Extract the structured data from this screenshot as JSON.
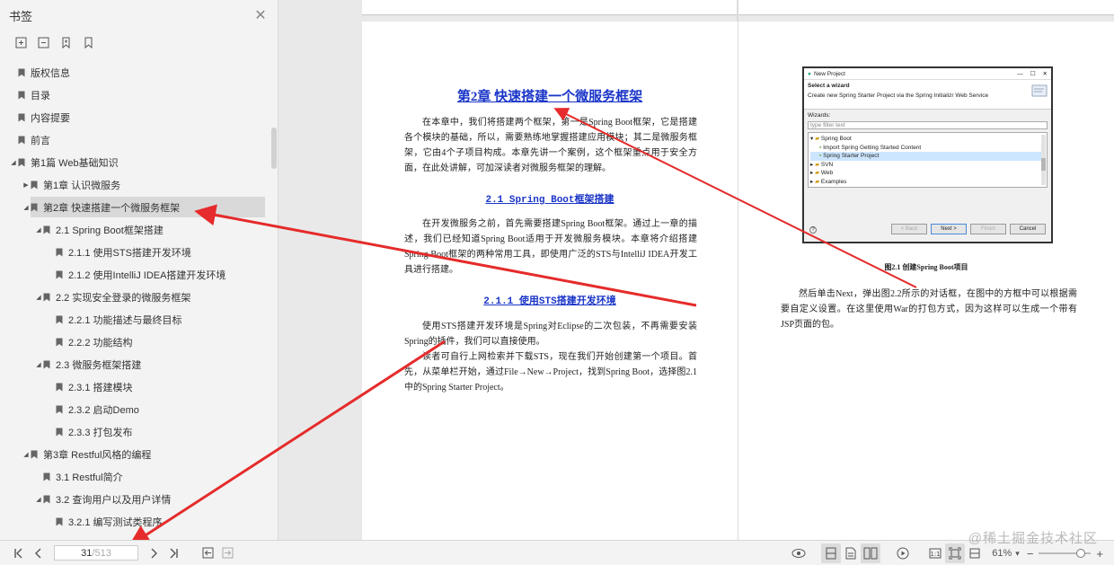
{
  "sidebar": {
    "title": "书签",
    "tree": [
      {
        "label": "版权信息",
        "level": 0,
        "caret": "none"
      },
      {
        "label": "目录",
        "level": 0,
        "caret": "none"
      },
      {
        "label": "内容提要",
        "level": 0,
        "caret": "none"
      },
      {
        "label": "前言",
        "level": 0,
        "caret": "none"
      },
      {
        "label": "第1篇 Web基础知识",
        "level": 0,
        "caret": "down"
      },
      {
        "label": "第1章 认识微服务",
        "level": 1,
        "caret": "right"
      },
      {
        "label": "第2章 快速搭建一个微服务框架",
        "level": 1,
        "caret": "down",
        "selected": true
      },
      {
        "label": "2.1 Spring Boot框架搭建",
        "level": 2,
        "caret": "down"
      },
      {
        "label": "2.1.1 使用STS搭建开发环境",
        "level": 3,
        "caret": "none"
      },
      {
        "label": "2.1.2 使用IntelliJ IDEA搭建开发环境",
        "level": 3,
        "caret": "none"
      },
      {
        "label": "2.2 实现安全登录的微服务框架",
        "level": 2,
        "caret": "down"
      },
      {
        "label": "2.2.1 功能描述与最终目标",
        "level": 3,
        "caret": "none"
      },
      {
        "label": "2.2.2 功能结构",
        "level": 3,
        "caret": "none"
      },
      {
        "label": "2.3 微服务框架搭建",
        "level": 2,
        "caret": "down"
      },
      {
        "label": "2.3.1 搭建模块",
        "level": 3,
        "caret": "none"
      },
      {
        "label": "2.3.2 启动Demo",
        "level": 3,
        "caret": "none"
      },
      {
        "label": "2.3.3 打包发布",
        "level": 3,
        "caret": "none"
      },
      {
        "label": "第3章 Restful风格的编程",
        "level": 1,
        "caret": "down"
      },
      {
        "label": "3.1 Restful简介",
        "level": 2,
        "caret": "none"
      },
      {
        "label": "3.2 查询用户以及用户详情",
        "level": 2,
        "caret": "down"
      },
      {
        "label": "3.2.1 编写测试类程序",
        "level": 3,
        "caret": "none"
      }
    ]
  },
  "left_page": {
    "chapter_title": "第2章 快速搭建一个微服务框架",
    "p1": "在本章中，我们将搭建两个框架，第一是Spring Boot框架，它是搭建各个模块的基础，所以，需要熟练地掌握搭建应用模块；其二是微服务框架，它由4个子项目构成。本章先讲一个案例，这个框架重点用于安全方面，在此处讲解，可加深读者对微服务框架的理解。",
    "sec_2_1": "2.1 Spring Boot框架搭建",
    "p2": "在开发微服务之前，首先需要搭建Spring Boot框架。通过上一章的描述，我们已经知道Spring Boot适用于开发微服务模块。本章将介绍搭建Spring Boot框架的两种常用工具，即使用广泛的STS与IntelliJ IDEA开发工具进行搭建。",
    "sec_2_1_1": "2.1.1 使用STS搭建开发环境",
    "p3": "使用STS搭建开发环境是Spring对Eclipse的二次包装，不再需要安装Spring的插件，我们可以直接使用。",
    "p4": "读者可自行上网检索并下载STS，现在我们开始创建第一个项目。首先，从菜单栏开始，通过File→New→Project，找到Spring Boot，选择图2.1中的Spring Starter Project。"
  },
  "right_page": {
    "wizard": {
      "window_title": "New Project",
      "heading": "Select a wizard",
      "subheading": "Create new Spring Starter Project via the Spring Initializr Web Service",
      "wizards_label": "Wizards:",
      "filter_placeholder": "type filter text",
      "items": [
        "Spring Boot",
        "Import Spring Getting Started Content",
        "Spring Starter Project",
        "SVN",
        "Web",
        "Examples"
      ],
      "btn_back": "< Back",
      "btn_next": "Next >",
      "btn_finish": "Finish",
      "btn_cancel": "Cancel",
      "help": "?"
    },
    "figure_caption": "图2.1 创建Spring Boot项目",
    "p1": "然后单击Next，弹出图2.2所示的对话框，在图中的方框中可以根据需要自定义设置。在这里使用War的打包方式，因为这样可以生成一个带有JSP页面的包。"
  },
  "toolbar": {
    "current_page": "31",
    "total_pages": "/513",
    "zoom": "61%"
  },
  "watermark": "@稀土掘金技术社区"
}
